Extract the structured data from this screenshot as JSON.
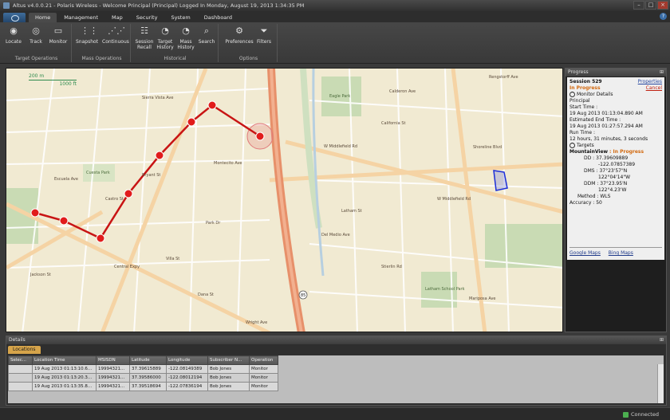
{
  "window": {
    "title": "Altus v4.0.0.21 - Polaris Wireless - Welcome Principal (Principal) Logged In Monday, August 19, 2013 1:34:35 PM",
    "controls": [
      "–",
      "□",
      "×"
    ]
  },
  "menu": {
    "tabs": [
      "Home",
      "Management",
      "Map",
      "Security",
      "System",
      "Dashboard"
    ],
    "active": "Home"
  },
  "ribbon": {
    "groups": [
      {
        "name": "Target Operations",
        "buttons": [
          {
            "label": "Locate",
            "icon": "locate-icon"
          },
          {
            "label": "Track",
            "icon": "track-icon"
          },
          {
            "label": "Monitor",
            "icon": "monitor-icon"
          }
        ]
      },
      {
        "name": "Mass Operations",
        "buttons": [
          {
            "label": "Snapshot",
            "icon": "snapshot-icon"
          },
          {
            "label": "Continuous",
            "icon": "continuous-icon"
          }
        ]
      },
      {
        "name": "Historical",
        "buttons": [
          {
            "label": "Session Recall",
            "icon": "session-recall-icon"
          },
          {
            "label": "Target History",
            "icon": "target-history-icon"
          },
          {
            "label": "Mass History",
            "icon": "mass-history-icon"
          },
          {
            "label": "Search",
            "icon": "search-icon"
          }
        ]
      },
      {
        "name": "Options",
        "buttons": [
          {
            "label": "Preferences",
            "icon": "gear-icon"
          },
          {
            "label": "Filters",
            "icon": "filter-icon"
          }
        ]
      }
    ]
  },
  "map": {
    "scale_top": "200 m",
    "scale_bottom": "1000 ft",
    "streets": [
      "W Middlefield Rd",
      "Sierra Vista Ave",
      "Castro St",
      "Central Expy",
      "Montecito Ave",
      "Del Medio Ave",
      "Rengstorff Ave",
      "Villa St",
      "Dana St",
      "California St",
      "Latham St",
      "Wright Ave",
      "Shoreline Blvd",
      "Escuela Ave",
      "Park Dr",
      "Stierlin Rd",
      "Jackson St",
      "Calderon Ave",
      "Mariposa Ave",
      "Bryant St"
    ],
    "highway_label": "85",
    "parks": [
      "Cuesta Park",
      "Eagle Park",
      "Latham School Park"
    ],
    "track_color": "#d01818"
  },
  "progress": {
    "header": "Progress",
    "session": "Session 529",
    "properties": "Properties",
    "status": "In Progress",
    "cancel": "Cancel",
    "monitor_details": "Monitor Details",
    "principal": "Principal",
    "start_label": "Start Time :",
    "start_value": "19 Aug 2013 01:13:04.890 AM",
    "est_end_label": "Estimated End Time :",
    "est_end_value": "19 Aug 2013 01:27:57.294 AM",
    "run_label": "Run Time :",
    "run_value": "12 hours, 31 minutes, 3 seconds",
    "targets": "Targets",
    "target_name": "MountainView",
    "target_status": ": In Progress",
    "dd_label": "DD : 37.39609889",
    "dd_lon": "-122.07857389",
    "dms_label": "DMS : 37°23'57\"N",
    "dms_lon": "122°04'14\"W",
    "ddm_label": "DDM : 37°23.95'N",
    "ddm_lon": "122°4.23'W",
    "method": "Method : WLS",
    "accuracy": "Accuracy : 50",
    "link_google": "Google Maps",
    "link_bing": "Bing Maps"
  },
  "details": {
    "header": "Details",
    "tab": "Locations",
    "columns": [
      "Selec...",
      "Location Time",
      "MSISDN",
      "Latitude",
      "Longitude",
      "Subscriber N...",
      "Operation"
    ],
    "rows": [
      [
        "",
        "19 Aug 2013 01:13:10.6...",
        "19994321...",
        "37.39615889",
        "-122.08149389",
        "Bob Jones",
        "Monitor"
      ],
      [
        "",
        "19 Aug 2013 01:13:20.3...",
        "19994321...",
        "37.39586000",
        "-122.08012194",
        "Bob Jones",
        "Monitor"
      ],
      [
        "",
        "19 Aug 2013 01:13:35.8...",
        "19994321...",
        "37.39518694",
        "-122.07836194",
        "Bob Jones",
        "Monitor"
      ]
    ]
  },
  "status": {
    "connection": "Connected"
  }
}
